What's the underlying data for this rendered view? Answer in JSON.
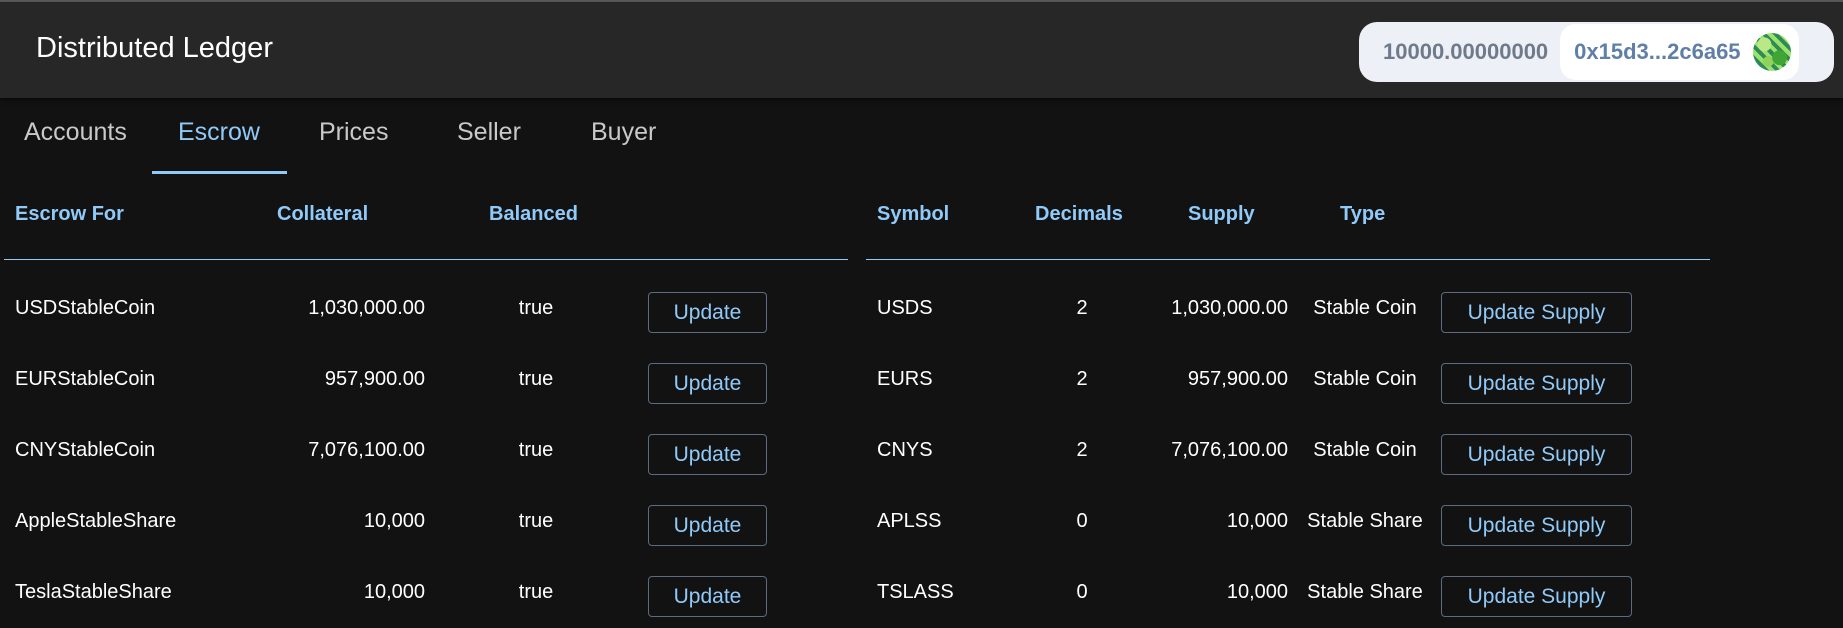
{
  "app": {
    "title": "Distributed Ledger"
  },
  "wallet": {
    "balance": "10000.00000000",
    "address": "0x15d3...2c6a65"
  },
  "tabs": [
    {
      "label": "Accounts"
    },
    {
      "label": "Escrow",
      "active": true
    },
    {
      "label": "Prices"
    },
    {
      "label": "Seller"
    },
    {
      "label": "Buyer"
    }
  ],
  "escrow": {
    "headers": {
      "escrow_for": "Escrow For",
      "collateral": "Collateral",
      "balanced": "Balanced"
    },
    "button_label": "Update",
    "rows": [
      {
        "name": "USDStableCoin",
        "collateral": "1,030,000.00",
        "balanced": "true"
      },
      {
        "name": "EURStableCoin",
        "collateral": "957,900.00",
        "balanced": "true"
      },
      {
        "name": "CNYStableCoin",
        "collateral": "7,076,100.00",
        "balanced": "true"
      },
      {
        "name": "AppleStableShare",
        "collateral": "10,000",
        "balanced": "true"
      },
      {
        "name": "TeslaStableShare",
        "collateral": "10,000",
        "balanced": "true"
      }
    ]
  },
  "tokens": {
    "headers": {
      "symbol": "Symbol",
      "decimals": "Decimals",
      "supply": "Supply",
      "type": "Type"
    },
    "button_label": "Update Supply",
    "rows": [
      {
        "symbol": "USDS",
        "decimals": "2",
        "supply": "1,030,000.00",
        "type": "Stable Coin"
      },
      {
        "symbol": "EURS",
        "decimals": "2",
        "supply": "957,900.00",
        "type": "Stable Coin"
      },
      {
        "symbol": "CNYS",
        "decimals": "2",
        "supply": "7,076,100.00",
        "type": "Stable Coin"
      },
      {
        "symbol": "APLSS",
        "decimals": "0",
        "supply": "10,000",
        "type": "Stable Share"
      },
      {
        "symbol": "TSLASS",
        "decimals": "0",
        "supply": "10,000",
        "type": "Stable Share"
      }
    ]
  },
  "colors": {
    "accent": "#90caf9",
    "appbar": "#272727",
    "background": "#121212"
  }
}
